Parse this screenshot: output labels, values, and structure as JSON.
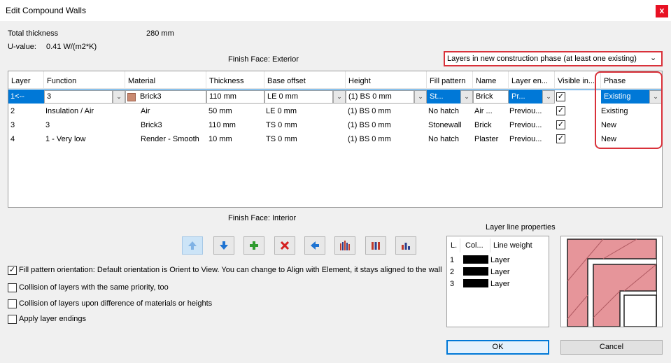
{
  "window": {
    "title": "Edit Compound Walls",
    "close_glyph": "x"
  },
  "summary": {
    "total_thickness_label": "Total thickness",
    "total_thickness_value": "280 mm",
    "uvalue_label": "U-value:",
    "uvalue_value": "0.41 W/(m2*K)"
  },
  "finish_exterior": "Finish Face: Exterior",
  "finish_interior": "Finish Face: Interior",
  "phase_filter": {
    "selected": "Layers in new construction phase (at least one existing)"
  },
  "table": {
    "columns": [
      "Layer",
      "Function",
      "Material",
      "Thickness",
      "Base offset",
      "Height",
      "Fill pattern",
      "Name",
      "Layer en...",
      "Visible in...",
      "Phase"
    ],
    "selected": {
      "layer": "1<--",
      "function": "3",
      "material": "Brick3",
      "thickness": "110 mm",
      "base_offset": "LE 0 mm",
      "height": "(1) BS 0 mm",
      "fill": "St...",
      "name": "Brick",
      "layer_end": "Pr...",
      "visible": true,
      "phase": "Existing"
    },
    "rows": [
      {
        "layer": "2",
        "function": "Insulation / Air",
        "material": "Air",
        "thickness": "50 mm",
        "base_offset": "LE 0 mm",
        "height": "(1) BS 0 mm",
        "fill": "No hatch",
        "name": "Air ...",
        "layer_end": "Previou...",
        "visible": true,
        "phase": "Existing"
      },
      {
        "layer": "3",
        "function": "3",
        "material": "Brick3",
        "thickness": "110 mm",
        "base_offset": "TS 0 mm",
        "height": "(1) BS 0 mm",
        "fill": "Stonewall",
        "name": "Brick",
        "layer_end": "Previou...",
        "visible": true,
        "phase": "New"
      },
      {
        "layer": "4",
        "function": "1 - Very low",
        "material": "Render - Smooth",
        "thickness": "10 mm",
        "base_offset": "TS 0 mm",
        "height": "(1) BS 0 mm",
        "fill": "No hatch",
        "name": "Plaster",
        "layer_end": "Previou...",
        "visible": true,
        "phase": "New"
      }
    ]
  },
  "toolbar": {
    "icons": [
      "move-up-icon",
      "move-down-icon",
      "add-layer-icon",
      "delete-layer-icon",
      "reverse-icon",
      "priority-icon",
      "layers-icon",
      "chart-icon"
    ]
  },
  "options": {
    "fill_orientation": {
      "label": "Fill pattern orientation: Default orientation is Orient to View. You can change to Align with Element, it stays aligned to the wall",
      "checked": true
    },
    "collision_priority": {
      "label": "Collision of layers with the same priority, too",
      "checked": false
    },
    "collision_materials": {
      "label": "Collision of layers upon difference of materials or heights",
      "checked": false
    },
    "layer_endings": {
      "label": "Apply layer endings",
      "checked": false
    }
  },
  "layer_line_properties": {
    "title": "Layer line properties",
    "headers": [
      "L.",
      "Col...",
      "Line weight"
    ],
    "rows": [
      {
        "num": "1",
        "color": "#000000",
        "weight": "Layer"
      },
      {
        "num": "2",
        "color": "#000000",
        "weight": "Layer"
      },
      {
        "num": "3",
        "color": "#000000",
        "weight": "Layer"
      }
    ]
  },
  "buttons": {
    "ok": "OK",
    "cancel": "Cancel"
  },
  "colors": {
    "selection": "#0078d7",
    "highlight_red": "#d9313a",
    "wall_fill": "#e6959a"
  }
}
